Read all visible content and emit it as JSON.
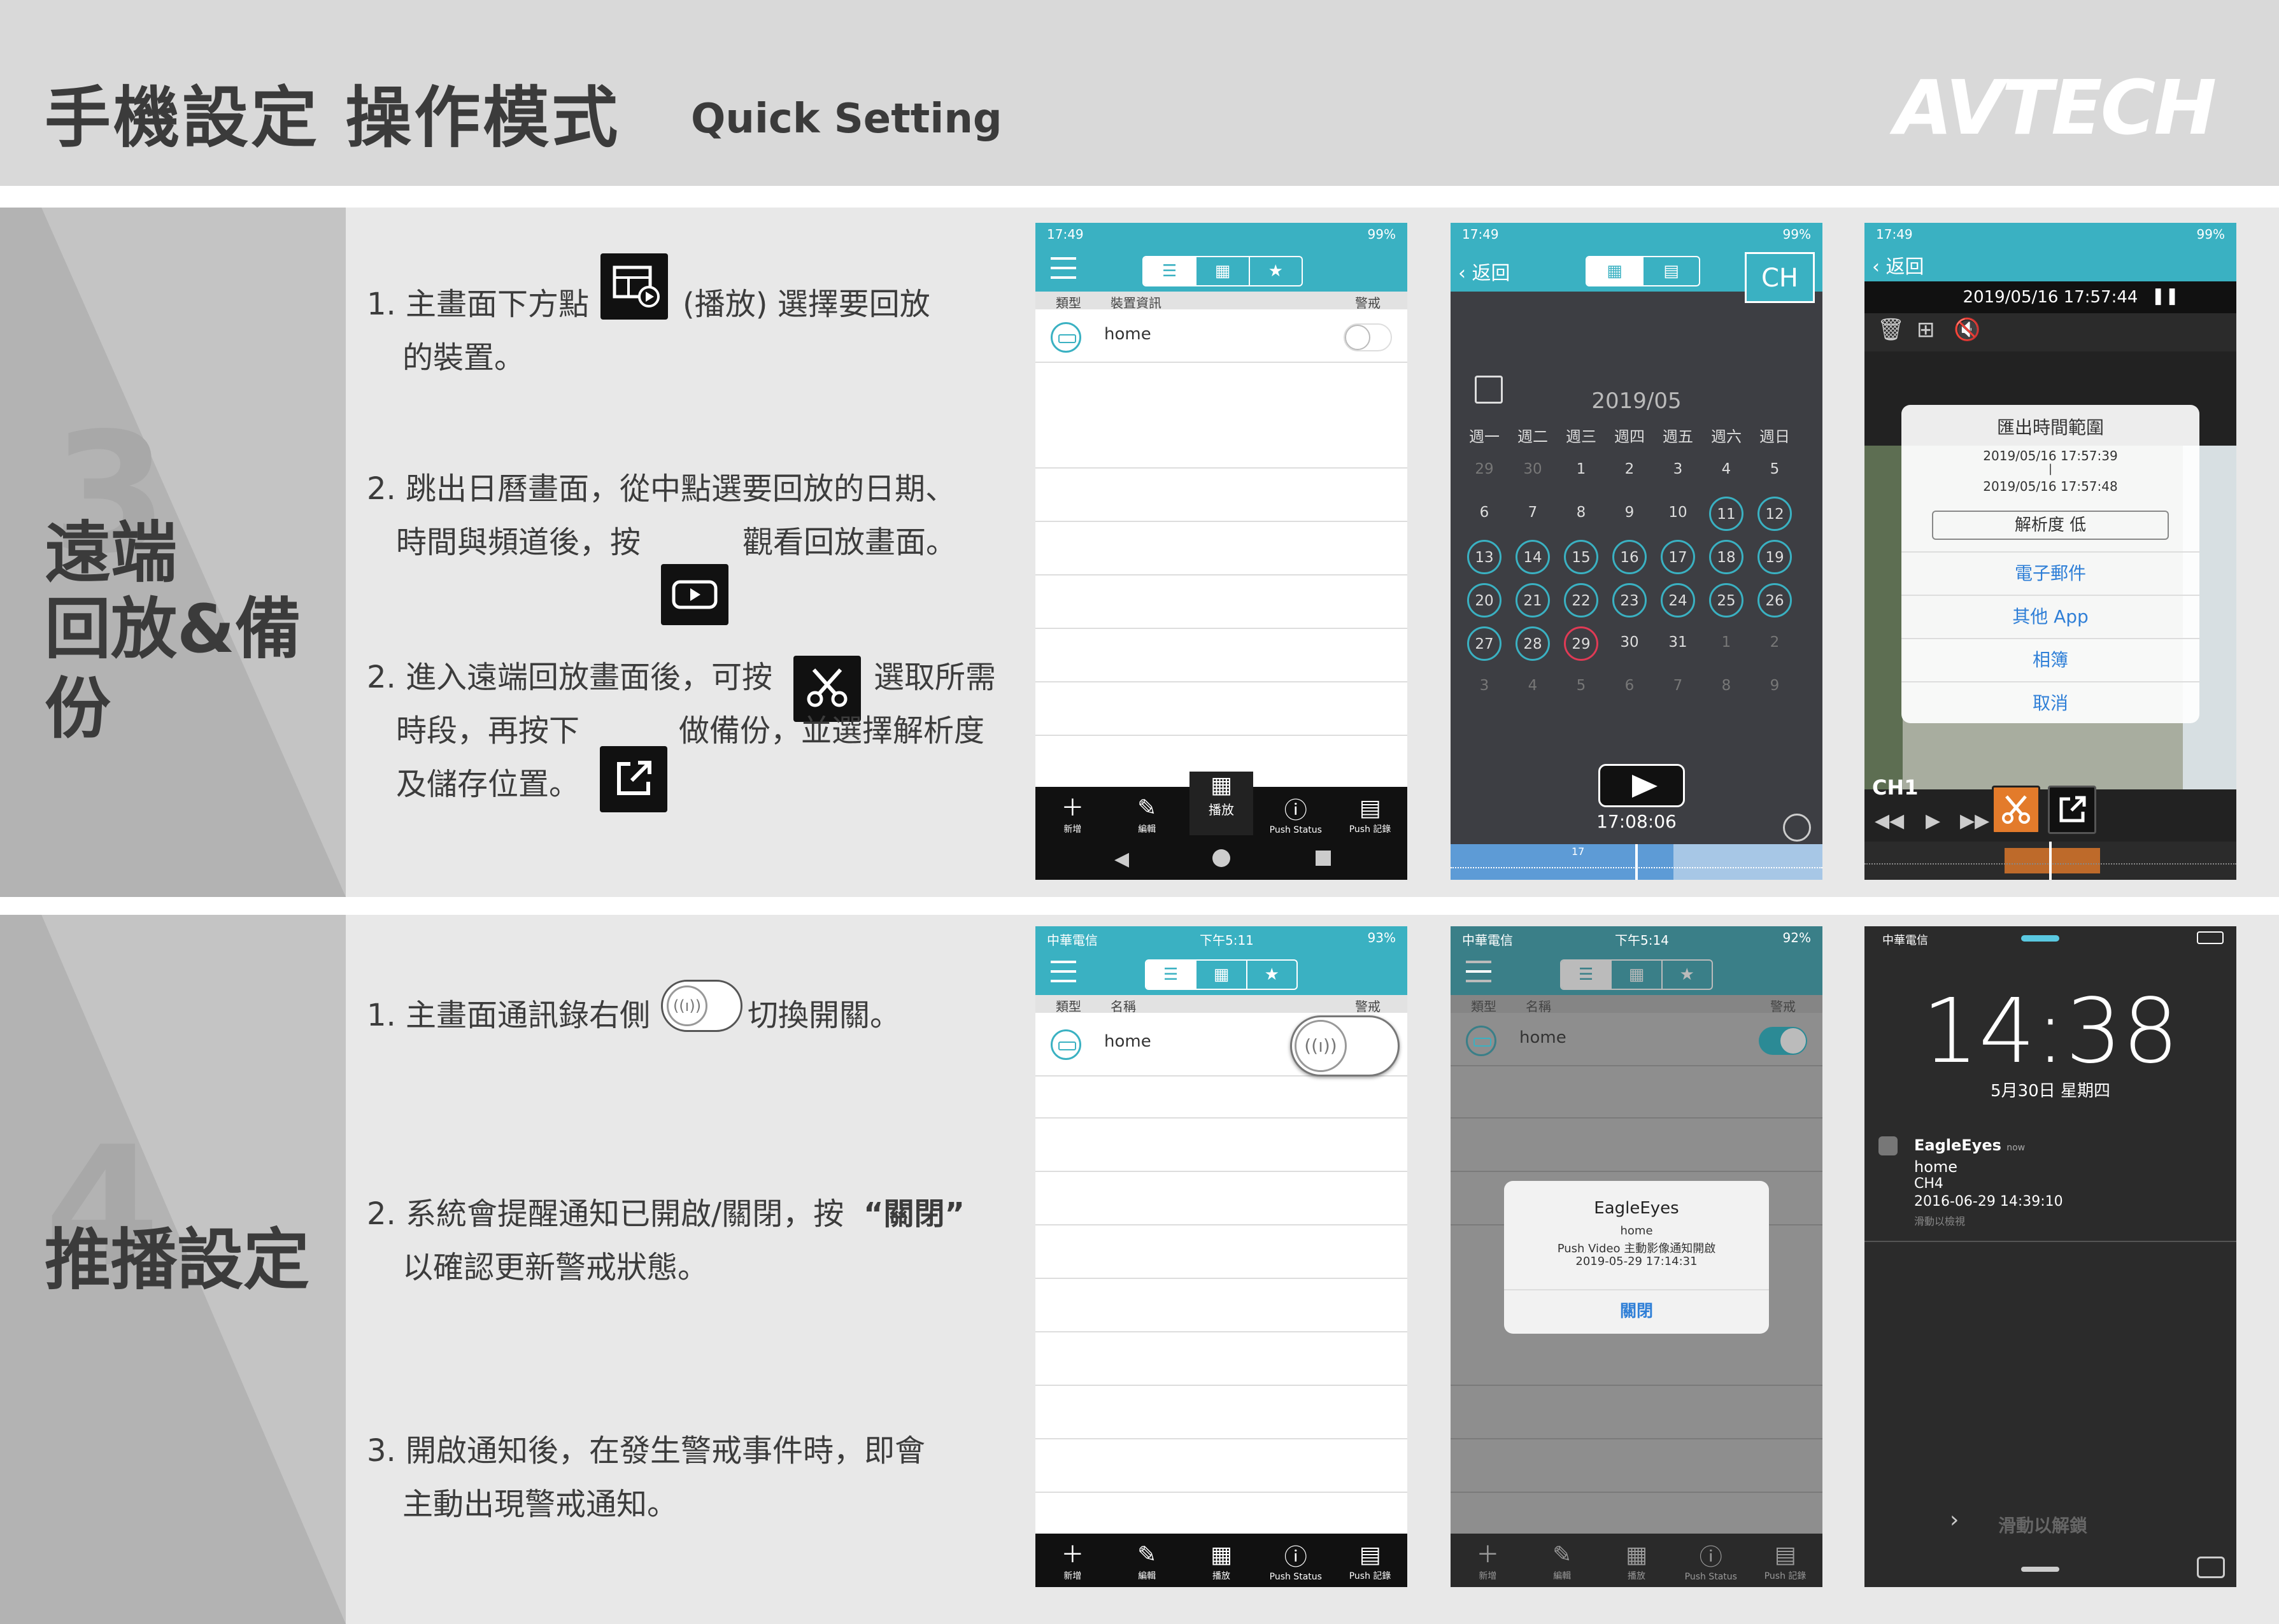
{
  "header": {
    "title": "手機設定  操作模式",
    "subtitle": "Quick Setting",
    "logo": "AVTECH"
  },
  "section3": {
    "number": "3",
    "title_line1": "遠端",
    "title_line2": "回放&備份",
    "step1_a": "1. 主畫面下方點",
    "step1_b": "(播放) 選擇要回放",
    "step1_c": "的裝置。",
    "step2_a": "2. 跳出日曆畫面，從中點選要回放的日期、",
    "step2_b": "時間與頻道後，按",
    "step2_c": "觀看回放畫面。",
    "step3_a": "2. 進入遠端回放畫面後，可按",
    "step3_b": "選取所需",
    "step3_c": "時段，再按下",
    "step3_d": "做備份，並選擇解析度",
    "step3_e": "及儲存位置。"
  },
  "section4": {
    "number": "4",
    "title": "推播設定",
    "step1_a": "1. 主畫面通訊錄右側",
    "step1_b": "切換開關。",
    "step2_a": "2. 系統會提醒通知已開啟/關閉，按",
    "step2_b": "“關閉”",
    "step2_c": "以確認更新警戒狀態。",
    "step3_a": "3. 開啟通知後，在發生警戒事件時，即會",
    "step3_b": "主動出現警戒通知。"
  },
  "phone_device_list": {
    "time": "17:49",
    "battery": "99%",
    "col_type": "類型",
    "col_info": "裝置資訊",
    "col_alarm": "警戒",
    "device": "home",
    "tabs": [
      "新增",
      "編輯",
      "播放",
      "Push Status",
      "Push 記錄"
    ]
  },
  "phone_calendar": {
    "time": "17:49",
    "battery": "99%",
    "back": "返回",
    "ch": "CH",
    "month": "2019/05",
    "weekdays": [
      "週一",
      "週二",
      "週三",
      "週四",
      "週五",
      "週六",
      "週日"
    ],
    "weeks": [
      [
        "29",
        "30",
        "1",
        "2",
        "3",
        "4",
        "5"
      ],
      [
        "6",
        "7",
        "8",
        "9",
        "10",
        "11",
        "12"
      ],
      [
        "13",
        "14",
        "15",
        "16",
        "17",
        "18",
        "19"
      ],
      [
        "20",
        "21",
        "22",
        "23",
        "24",
        "25",
        "26"
      ],
      [
        "27",
        "28",
        "29",
        "30",
        "31",
        "1",
        "2"
      ],
      [
        "3",
        "4",
        "5",
        "6",
        "7",
        "8",
        "9"
      ]
    ],
    "time_label": "17:08:06",
    "tick": "17"
  },
  "phone_playback": {
    "time": "17:49",
    "battery": "99%",
    "back": "返回",
    "datetime": "2019/05/16 17:57:44",
    "sheet_title": "匯出時間範圍",
    "range_start": "2019/05/16 17:57:39",
    "range_sep": "|",
    "range_end": "2019/05/16 17:57:48",
    "resolution": "解析度 低",
    "opt_email": "電子郵件",
    "opt_other": "其他 App",
    "opt_album": "相簿",
    "opt_cancel": "取消",
    "channel": "CH1"
  },
  "phone_push_list": {
    "carrier": "中華電信",
    "time": "下午5:11",
    "battery": "93%",
    "col_type": "類型",
    "col_name": "名稱",
    "col_alarm": "警戒",
    "device": "home",
    "tabs": [
      "新增",
      "編輯",
      "播放",
      "Push Status",
      "Push 記錄"
    ]
  },
  "phone_push_alert": {
    "carrier": "中華電信",
    "time": "下午5:14",
    "battery": "92%",
    "col_type": "類型",
    "col_name": "名稱",
    "col_alarm": "警戒",
    "device": "home",
    "alert_title": "EagleEyes",
    "alert_line1": "home",
    "alert_line2": "Push Video 主動影像通知開啟",
    "alert_line3": "2019-05-29 17:14:31",
    "alert_button": "關閉",
    "tabs": [
      "新增",
      "編輯",
      "播放",
      "Push Status",
      "Push 記錄"
    ]
  },
  "phone_lock": {
    "carrier": "中華電信",
    "clock": "14:38",
    "date": "5月30日 星期四",
    "app": "EagleEyes",
    "ago": "now",
    "n_line1": "home",
    "n_line2": "CH4",
    "n_line3": "2016-06-29 14:39:10",
    "n_hint": "滑動以檢視",
    "unlock": "滑動以解鎖"
  },
  "colors": {
    "teal": "#3ab1c2",
    "dark_ui": "#3d3e43",
    "header_bg": "#d9d9d9",
    "section_bg": "#e8e8e8",
    "highlight": "#e37b2b"
  }
}
